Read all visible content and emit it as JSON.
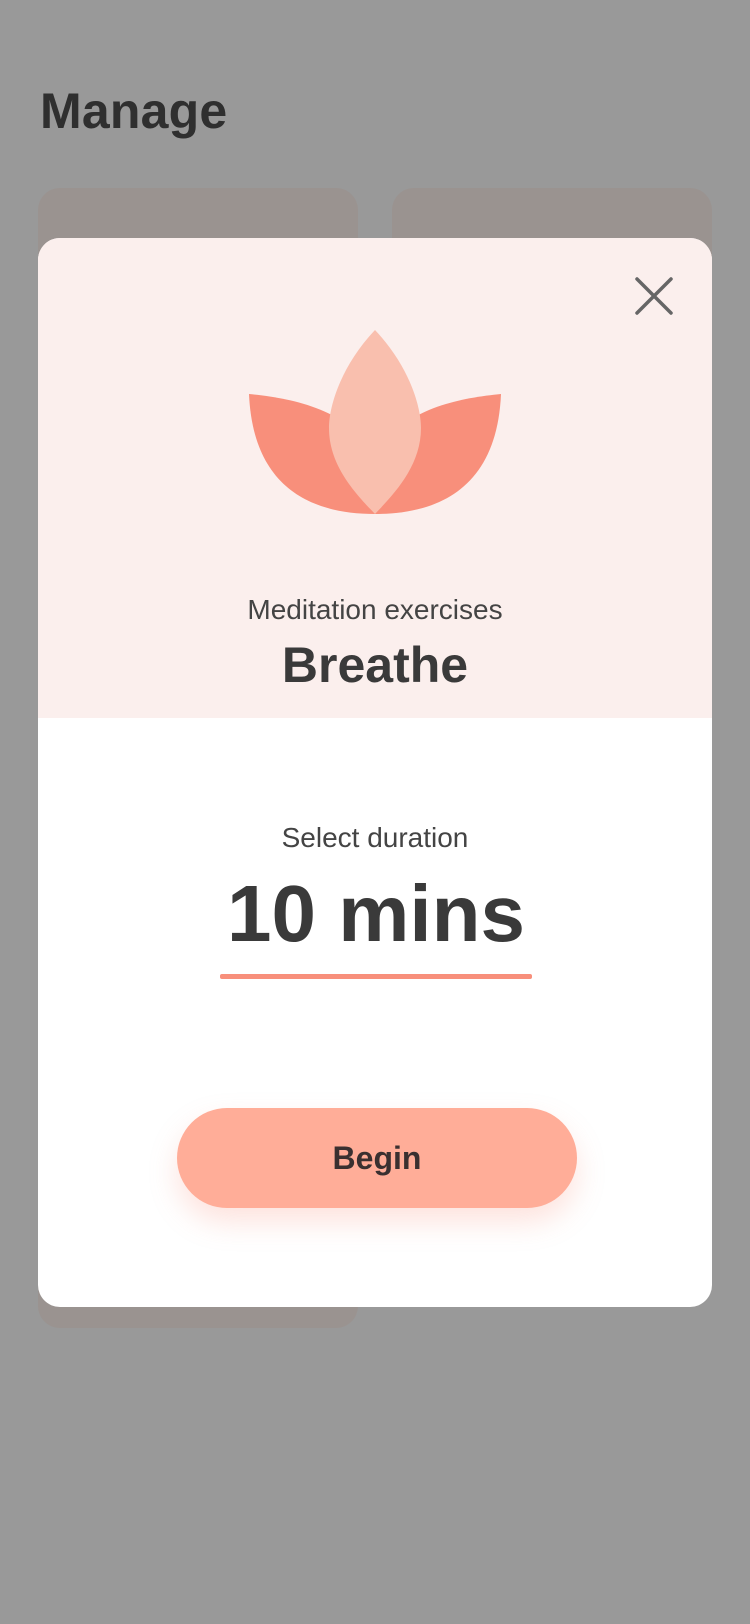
{
  "page": {
    "title": "Manage"
  },
  "modal": {
    "close_icon": "close-icon",
    "illustration": "lotus-icon",
    "category": "Meditation exercises",
    "title": "Breathe",
    "duration_label": "Select duration",
    "duration_value": "10 mins",
    "begin_label": "Begin"
  },
  "colors": {
    "overlay": "#999999",
    "header_bg": "#fbefed",
    "accent": "#f88f7b",
    "button": "#ffad98",
    "petal_outer": "#f88f7b",
    "petal_center": "#f9bfae",
    "text_dark": "#3a3a3a"
  }
}
